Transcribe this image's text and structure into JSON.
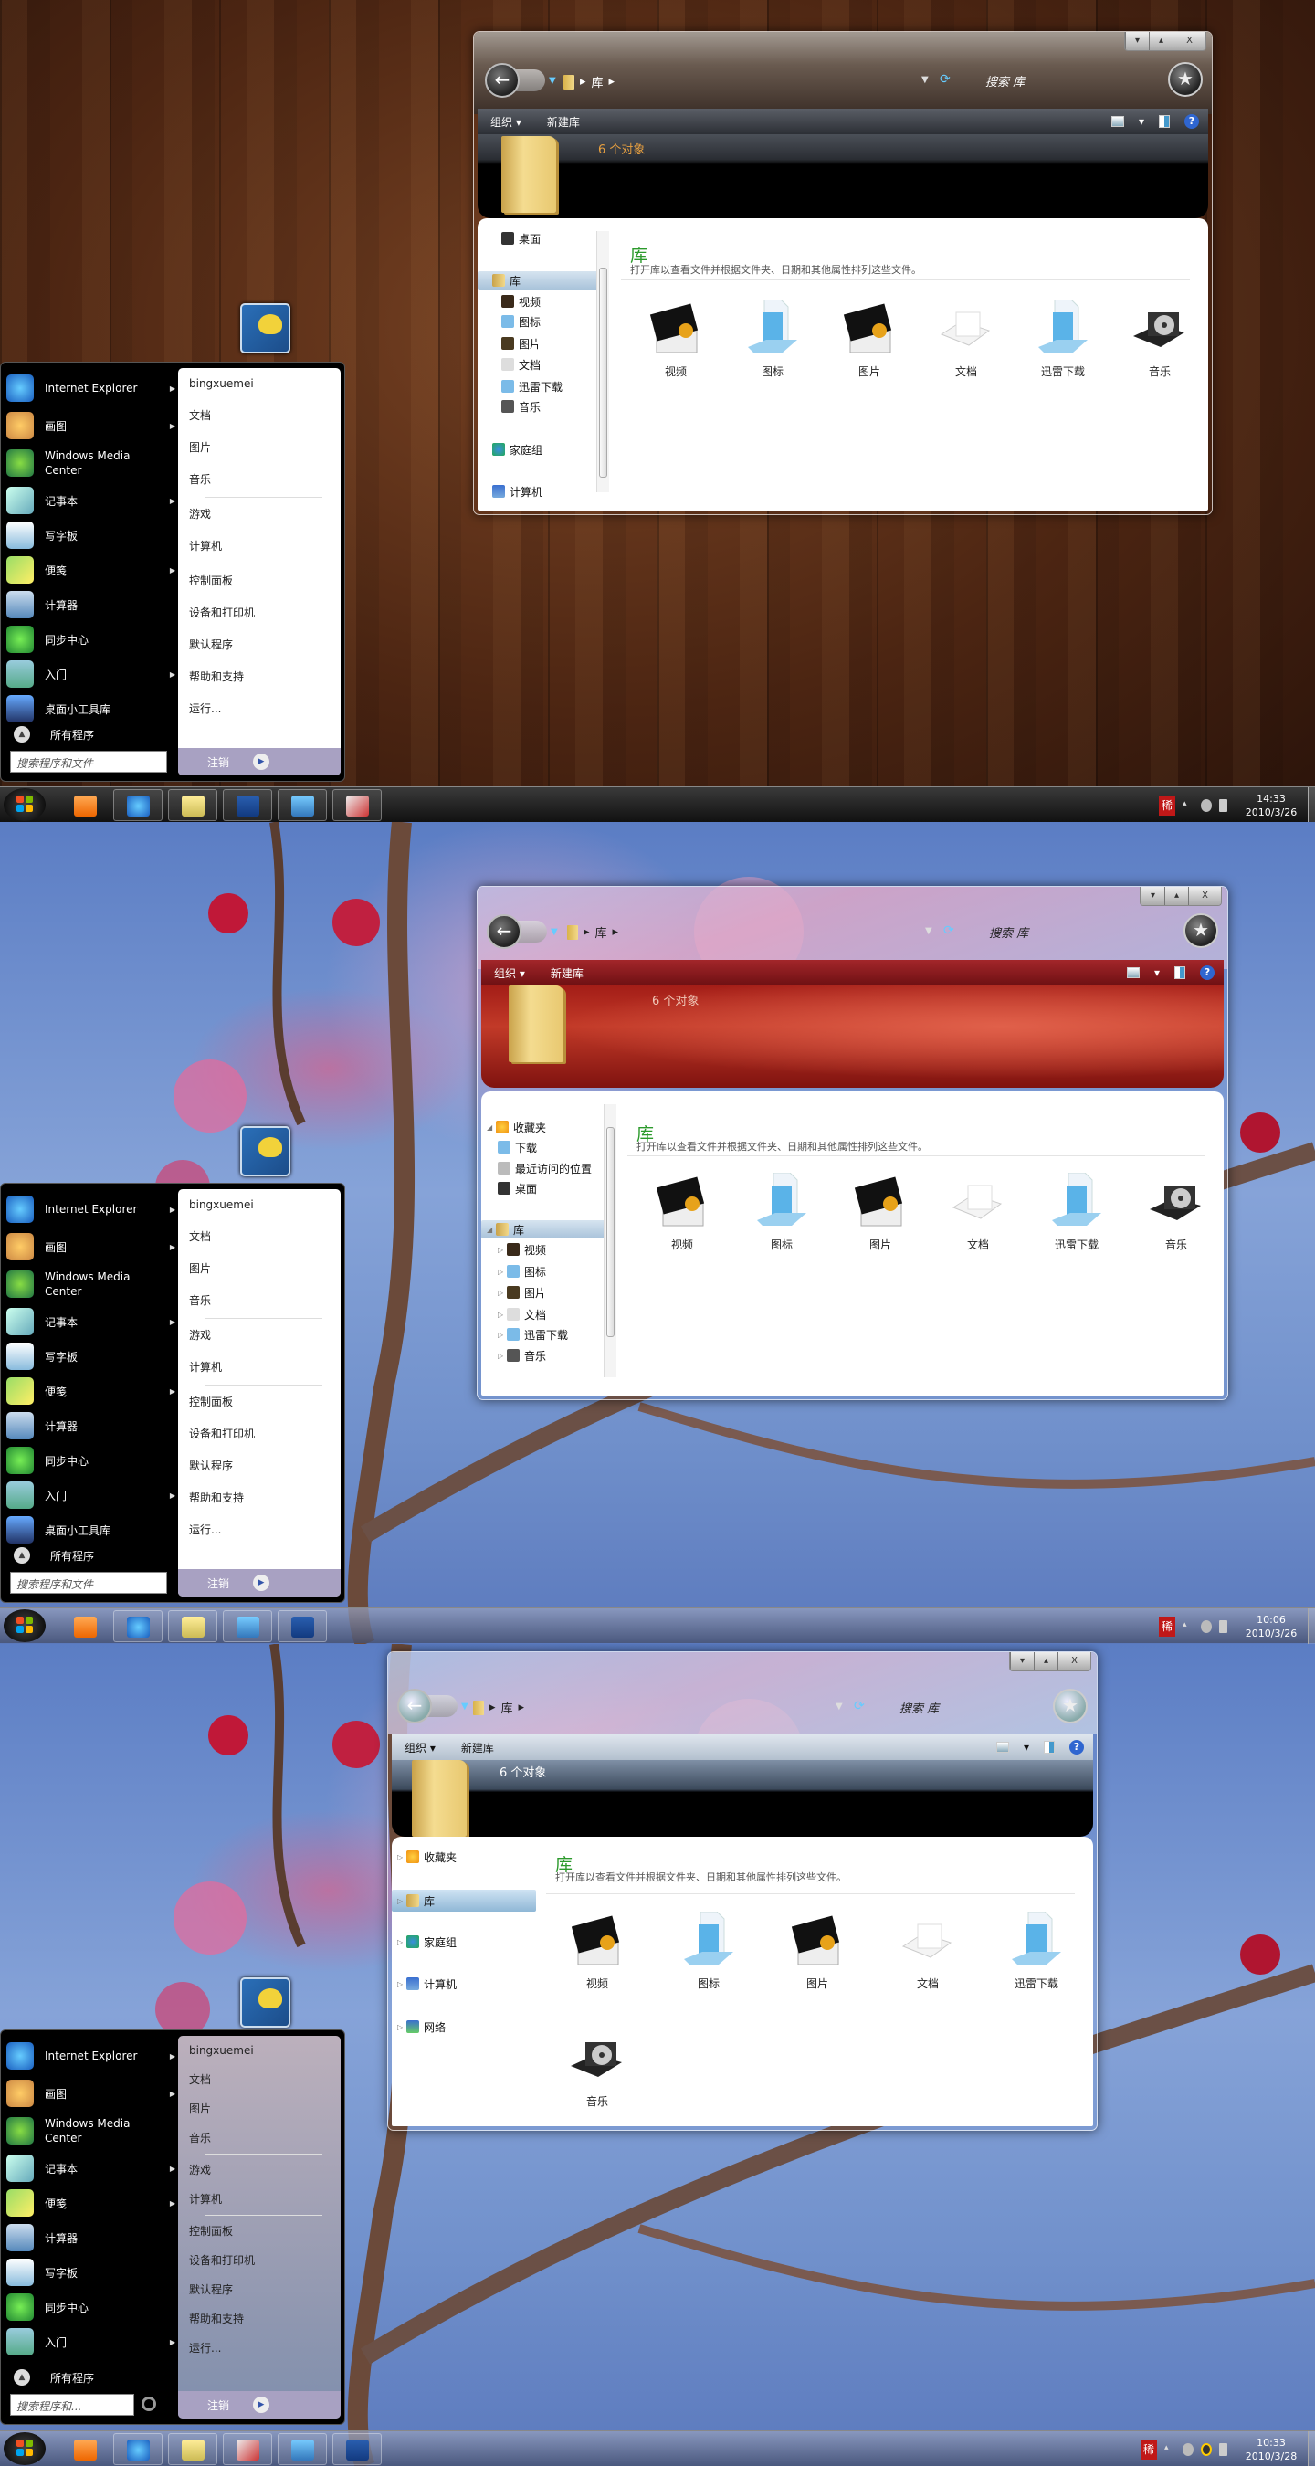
{
  "screens": [
    {
      "wallpaper": "dark-wood",
      "window": {
        "breadcrumb": [
          "库"
        ],
        "search_placeholder": "搜索 库",
        "caption_buttons": [
          "▾",
          "▴",
          "X"
        ],
        "toolbar": {
          "organize": "组织 ▾",
          "new_library": "新建库"
        },
        "item_count": "6 个对象",
        "heading": "库",
        "description": "打开库以查看文件并根据文件夹、日期和其他属性排列这些文件。",
        "nav": [
          {
            "label": "桌面",
            "icon": "desktop-icon",
            "level": 1
          },
          {
            "label": "库",
            "icon": "library-icon",
            "level": 0,
            "selected": true
          },
          {
            "label": "视频",
            "icon": "video-icon",
            "level": 1
          },
          {
            "label": "图标",
            "icon": "icons-icon",
            "level": 1
          },
          {
            "label": "图片",
            "icon": "pictures-icon",
            "level": 1
          },
          {
            "label": "文档",
            "icon": "documents-icon",
            "level": 1
          },
          {
            "label": "迅雷下载",
            "icon": "downloads-icon",
            "level": 1
          },
          {
            "label": "音乐",
            "icon": "music-icon",
            "level": 1
          },
          {
            "label": "家庭组",
            "icon": "homegroup-icon",
            "level": 0
          },
          {
            "label": "计算机",
            "icon": "computer-icon",
            "level": 0
          }
        ],
        "items": [
          {
            "label": "视频",
            "icon": "video-library-icon"
          },
          {
            "label": "图标",
            "icon": "icons-library-icon"
          },
          {
            "label": "图片",
            "icon": "pictures-library-icon"
          },
          {
            "label": "文档",
            "icon": "documents-library-icon"
          },
          {
            "label": "迅雷下载",
            "icon": "downloads-library-icon"
          },
          {
            "label": "音乐",
            "icon": "music-library-icon"
          }
        ]
      },
      "start_menu": {
        "programs": [
          {
            "label": "Internet Explorer",
            "icon": "internet-explorer-icon",
            "submenu": true
          },
          {
            "label": "画图",
            "icon": "paint-icon",
            "submenu": true
          },
          {
            "label": "Windows Media Center",
            "icon": "media-center-icon",
            "submenu": false
          },
          {
            "label": "记事本",
            "icon": "notepad-icon",
            "submenu": true
          },
          {
            "label": "写字板",
            "icon": "wordpad-icon",
            "submenu": false
          },
          {
            "label": "便笺",
            "icon": "sticky-notes-icon",
            "submenu": true
          },
          {
            "label": "计算器",
            "icon": "calculator-icon",
            "submenu": false
          },
          {
            "label": "同步中心",
            "icon": "sync-center-icon",
            "submenu": false
          },
          {
            "label": "入门",
            "icon": "getting-started-icon",
            "submenu": true
          },
          {
            "label": "桌面小工具库",
            "icon": "gadgets-icon",
            "submenu": false
          }
        ],
        "all_programs": "所有程序",
        "search_placeholder": "搜索程序和文件",
        "places": [
          "bingxuemei",
          "文档",
          "图片",
          "音乐",
          "|",
          "游戏",
          "计算机",
          "|",
          "控制面板",
          "设备和打印机",
          "默认程序",
          "帮助和支持",
          "运行..."
        ],
        "logoff": "注销"
      },
      "taskbar": {
        "buttons": [
          "media-player-icon",
          "internet-explorer-icon",
          "explorer-icon",
          "photoshop-icon",
          "control-panel-icon",
          "pen-tool-icon"
        ],
        "ime": "稀",
        "time": "14:33",
        "date": "2010/3/26"
      }
    },
    {
      "wallpaper": "plum-blossom-sky",
      "window": {
        "breadcrumb": [
          "库"
        ],
        "search_placeholder": "搜索 库",
        "caption_buttons": [
          "▾",
          "▴",
          "X"
        ],
        "toolbar": {
          "organize": "组织 ▾",
          "new_library": "新建库"
        },
        "item_count": "6 个对象",
        "heading": "库",
        "description": "打开库以查看文件并根据文件夹、日期和其他属性排列这些文件。",
        "nav": [
          {
            "label": "收藏夹",
            "icon": "favorites-star-icon",
            "level": 0,
            "expander": "expanded"
          },
          {
            "label": "下载",
            "icon": "downloads-icon",
            "level": 1
          },
          {
            "label": "最近访问的位置",
            "icon": "recent-places-icon",
            "level": 1
          },
          {
            "label": "桌面",
            "icon": "desktop-icon",
            "level": 1
          },
          {
            "label": "库",
            "icon": "library-icon",
            "level": 0,
            "selected": true,
            "expander": "expanded"
          },
          {
            "label": "视频",
            "icon": "video-icon",
            "level": 1,
            "expander": "collapsed"
          },
          {
            "label": "图标",
            "icon": "icons-icon",
            "level": 1,
            "expander": "collapsed"
          },
          {
            "label": "图片",
            "icon": "pictures-icon",
            "level": 1,
            "expander": "collapsed"
          },
          {
            "label": "文档",
            "icon": "documents-icon",
            "level": 1,
            "expander": "collapsed"
          },
          {
            "label": "迅雷下载",
            "icon": "downloads-icon",
            "level": 1,
            "expander": "collapsed"
          },
          {
            "label": "音乐",
            "icon": "music-icon",
            "level": 1,
            "expander": "collapsed"
          }
        ],
        "items": [
          {
            "label": "视频",
            "icon": "video-library-icon"
          },
          {
            "label": "图标",
            "icon": "icons-library-icon"
          },
          {
            "label": "图片",
            "icon": "pictures-library-icon"
          },
          {
            "label": "文档",
            "icon": "documents-library-icon"
          },
          {
            "label": "迅雷下载",
            "icon": "downloads-library-icon"
          },
          {
            "label": "音乐",
            "icon": "music-library-icon"
          }
        ]
      },
      "start_menu": {
        "programs": [
          {
            "label": "Internet Explorer",
            "icon": "internet-explorer-icon",
            "submenu": true
          },
          {
            "label": "画图",
            "icon": "paint-icon",
            "submenu": true
          },
          {
            "label": "Windows Media Center",
            "icon": "media-center-icon",
            "submenu": false
          },
          {
            "label": "记事本",
            "icon": "notepad-icon",
            "submenu": true
          },
          {
            "label": "写字板",
            "icon": "wordpad-icon",
            "submenu": false
          },
          {
            "label": "便笺",
            "icon": "sticky-notes-icon",
            "submenu": true
          },
          {
            "label": "计算器",
            "icon": "calculator-icon",
            "submenu": false
          },
          {
            "label": "同步中心",
            "icon": "sync-center-icon",
            "submenu": false
          },
          {
            "label": "入门",
            "icon": "getting-started-icon",
            "submenu": true
          },
          {
            "label": "桌面小工具库",
            "icon": "gadgets-icon",
            "submenu": false
          }
        ],
        "all_programs": "所有程序",
        "search_placeholder": "搜索程序和文件",
        "places": [
          "bingxuemei",
          "文档",
          "图片",
          "音乐",
          "|",
          "游戏",
          "计算机",
          "|",
          "控制面板",
          "设备和打印机",
          "默认程序",
          "帮助和支持",
          "运行..."
        ],
        "logoff": "注销"
      },
      "taskbar": {
        "buttons": [
          "media-player-icon",
          "internet-explorer-icon",
          "explorer-icon",
          "control-panel-icon",
          "photoshop-icon"
        ],
        "ime": "稀",
        "time": "10:06",
        "date": "2010/3/26"
      }
    },
    {
      "wallpaper": "plum-blossom-sky",
      "window": {
        "breadcrumb": [
          "库"
        ],
        "search_placeholder": "搜索 库",
        "caption_buttons": [
          "▾",
          "▴",
          "X"
        ],
        "toolbar": {
          "organize": "组织 ▾",
          "new_library": "新建库"
        },
        "item_count": "6 个对象",
        "heading": "库",
        "description": "打开库以查看文件并根据文件夹、日期和其他属性排列这些文件。",
        "nav": [
          {
            "label": "收藏夹",
            "icon": "favorites-star-icon",
            "level": 0,
            "expander": "collapsed"
          },
          {
            "label": "库",
            "icon": "library-icon",
            "level": 0,
            "selected": true,
            "expander": "collapsed"
          },
          {
            "label": "家庭组",
            "icon": "homegroup-icon",
            "level": 0,
            "expander": "collapsed"
          },
          {
            "label": "计算机",
            "icon": "computer-icon",
            "level": 0,
            "expander": "collapsed"
          },
          {
            "label": "网络",
            "icon": "network-icon",
            "level": 0,
            "expander": "collapsed"
          }
        ],
        "items": [
          {
            "label": "视频",
            "icon": "video-library-icon"
          },
          {
            "label": "图标",
            "icon": "icons-library-icon"
          },
          {
            "label": "图片",
            "icon": "pictures-library-icon"
          },
          {
            "label": "文档",
            "icon": "documents-library-icon"
          },
          {
            "label": "迅雷下载",
            "icon": "downloads-library-icon"
          },
          {
            "label": "音乐",
            "icon": "music-library-icon"
          }
        ]
      },
      "start_menu": {
        "programs": [
          {
            "label": "Internet Explorer",
            "icon": "internet-explorer-icon",
            "submenu": true
          },
          {
            "label": "画图",
            "icon": "paint-icon",
            "submenu": true
          },
          {
            "label": "Windows Media Center",
            "icon": "media-center-icon",
            "submenu": false
          },
          {
            "label": "记事本",
            "icon": "notepad-icon",
            "submenu": true
          },
          {
            "label": "便笺",
            "icon": "sticky-notes-icon",
            "submenu": true
          },
          {
            "label": "计算器",
            "icon": "calculator-icon",
            "submenu": false
          },
          {
            "label": "写字板",
            "icon": "wordpad-icon",
            "submenu": false
          },
          {
            "label": "同步中心",
            "icon": "sync-center-icon",
            "submenu": false
          },
          {
            "label": "入门",
            "icon": "getting-started-icon",
            "submenu": true
          }
        ],
        "all_programs": "所有程序",
        "search_placeholder": "搜索程序和...",
        "places": [
          "bingxuemei",
          "文档",
          "图片",
          "音乐",
          "|",
          "游戏",
          "计算机",
          "|",
          "控制面板",
          "设备和打印机",
          "默认程序",
          "帮助和支持",
          "运行..."
        ],
        "logoff": "注销"
      },
      "taskbar": {
        "buttons": [
          "media-player-icon",
          "internet-explorer-icon",
          "explorer-icon",
          "pen-tool-icon",
          "control-panel-icon",
          "photoshop-icon"
        ],
        "ime": "稀",
        "time": "10:33",
        "date": "2010/3/28"
      }
    }
  ]
}
